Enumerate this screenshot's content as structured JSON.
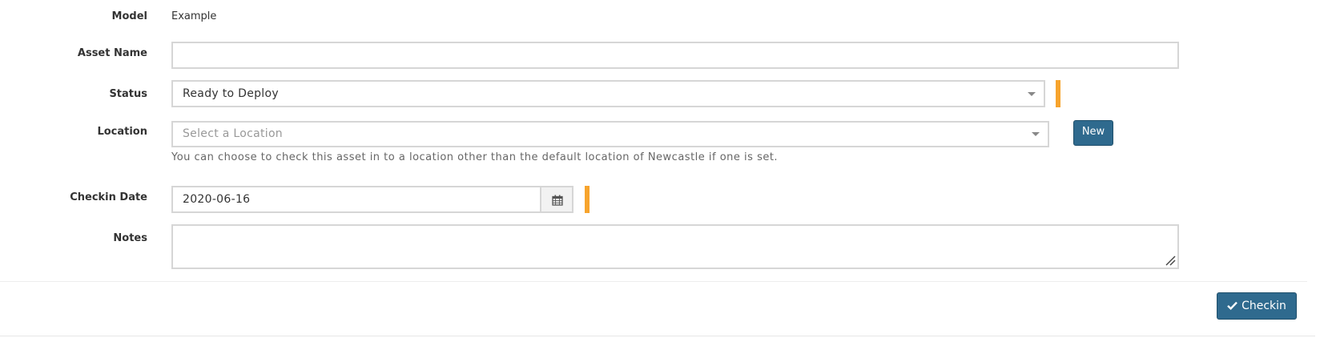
{
  "form": {
    "model": {
      "label": "Model",
      "value": "Example"
    },
    "asset_name": {
      "label": "Asset Name",
      "value": "",
      "placeholder": ""
    },
    "status": {
      "label": "Status",
      "selected": "Ready to Deploy"
    },
    "location": {
      "label": "Location",
      "placeholder": "Select a Location",
      "new_button": "New",
      "help_text": "You can choose to check this asset in to a location other than the default location of Newcastle if one is set."
    },
    "checkin_date": {
      "label": "Checkin Date",
      "value": "2020-06-16"
    },
    "notes": {
      "label": "Notes",
      "value": ""
    }
  },
  "footer": {
    "checkin_button": "Checkin"
  },
  "colors": {
    "primary_button": "#2f6a8e",
    "required_indicator": "#f7a42d",
    "input_border": "#d6d6d6"
  },
  "icons": {
    "status_dropdown": "caret-down-icon",
    "location_dropdown": "caret-down-icon",
    "date_picker": "calendar-icon",
    "checkin": "check-icon",
    "notes_resize": "resize-grip-icon"
  }
}
